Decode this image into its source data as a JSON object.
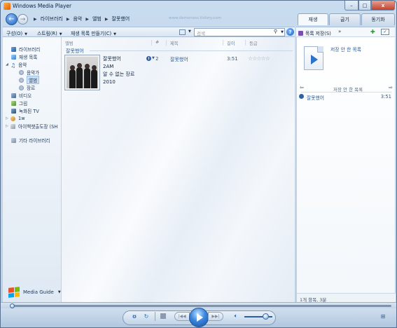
{
  "window": {
    "title": "Windows Media Player",
    "close": "x",
    "max": "□",
    "min": "–"
  },
  "nav": {
    "back": "←",
    "forward": "→",
    "breadcrumbs": [
      "라이브러리",
      "음악",
      "앨범",
      "잘못했어"
    ],
    "ghost_url": "www.demonoss.tistory.com"
  },
  "tabs": [
    "재생",
    "굽기",
    "동기화"
  ],
  "toolbar": {
    "organize": "구성(O)",
    "stream": "스트림(R)",
    "create_playlist": "재생 목록 만들기(C)",
    "search_placeholder": "검색",
    "help": "?"
  },
  "right_toolbar": {
    "save_list": "목록 저장(S)",
    "more": "»"
  },
  "sidebar": {
    "items": [
      {
        "label": "라이브러리",
        "icon": "library-icon"
      },
      {
        "label": "재생 목록",
        "icon": "playlist-icon"
      },
      {
        "label": "음악",
        "icon": "music-note-icon"
      },
      {
        "label": "음악가",
        "icon": "artist-icon"
      },
      {
        "label": "앨범",
        "icon": "album-icon"
      },
      {
        "label": "장르",
        "icon": "genre-icon"
      },
      {
        "label": "비디오",
        "icon": "video-icon"
      },
      {
        "label": "그림",
        "icon": "picture-icon"
      },
      {
        "label": "녹화된 TV",
        "icon": "recorded-tv-icon"
      },
      {
        "label": "1w",
        "icon": "user-library-icon"
      },
      {
        "label": "아이백챗출도장 (SH",
        "icon": "device-icon"
      },
      {
        "label": "기타 라이브러리",
        "icon": "other-libraries-icon"
      }
    ],
    "media_guide": "Media Guide"
  },
  "library": {
    "columns": [
      "앨범",
      "#",
      "제목",
      "길이",
      "등급"
    ],
    "group": "잘못했어",
    "album": {
      "title": "잘못했어",
      "artist": "2AM",
      "genre": "알 수 없는 장르",
      "year": "2010"
    },
    "track": {
      "number": "2",
      "title": "잘못했어",
      "length": "3:51",
      "rating": "☆☆☆☆☆"
    }
  },
  "list_pane": {
    "unsaved_title": "저장 안 한 목록",
    "nav_title": "저장 안 한 목록",
    "items": [
      {
        "title": "잘못했어",
        "duration": "3:51"
      }
    ],
    "footer": "1개 항목, 3분"
  },
  "player": {
    "seek_progress": 0.0,
    "volume": 0.75
  },
  "colors": {
    "accent": "#2f72c9",
    "link": "#2a5d9c",
    "close": "#c1432e"
  }
}
